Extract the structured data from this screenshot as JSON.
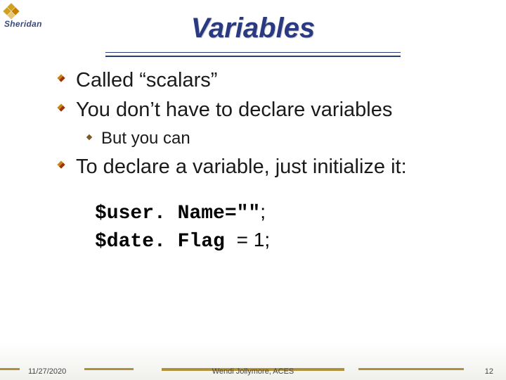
{
  "logo_text": "Sheridan",
  "title": "Variables",
  "bullets": {
    "b1": "Called “scalars”",
    "b2": "You don’t have to declare variables",
    "b2_sub": "But you can",
    "b3": "To declare a variable, just initialize it:"
  },
  "code": {
    "line1_bold": "$user. Name=\"\"",
    "line1_tail": ";",
    "line2_bold": "$date. Flag ",
    "line2_tail": "= 1;"
  },
  "footer": {
    "date": "11/27/2020",
    "center": "Wendi Jollymore, ACES",
    "page": "12"
  }
}
